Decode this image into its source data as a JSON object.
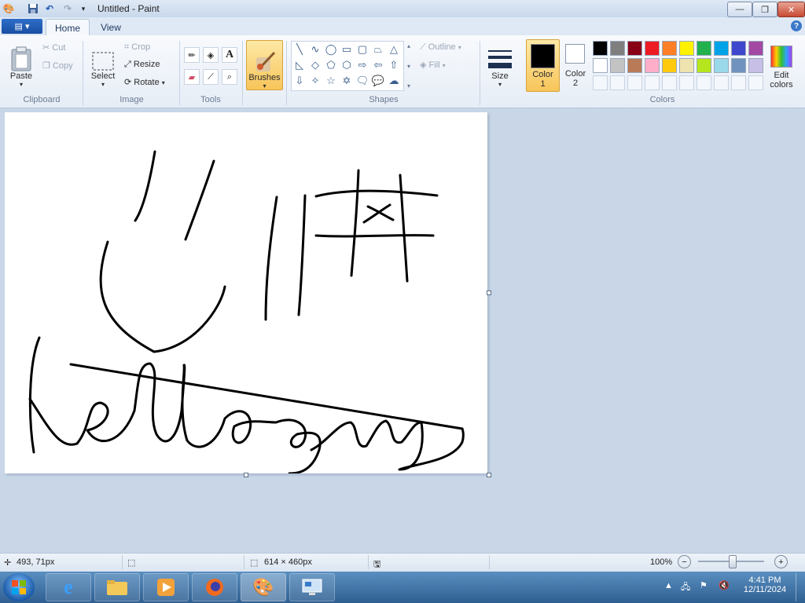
{
  "window": {
    "title": "Untitled - Paint",
    "minimize": "—",
    "maximize": "❐",
    "close": "✕"
  },
  "tabs": [
    {
      "label": "Home"
    },
    {
      "label": "View"
    }
  ],
  "ribbon": {
    "clipboard": {
      "group": "Clipboard",
      "paste": "Paste",
      "cut": "Cut",
      "copy": "Copy"
    },
    "image": {
      "group": "Image",
      "select": "Select",
      "crop": "Crop",
      "resize": "Resize",
      "rotate": "Rotate"
    },
    "tools": {
      "group": "Tools"
    },
    "brushes": {
      "label": "Brushes"
    },
    "shapes": {
      "group": "Shapes",
      "outline": "Outline",
      "fill": "Fill"
    },
    "size": {
      "label": "Size"
    },
    "color1": {
      "label": "Color",
      "num": "1",
      "value": "#000000"
    },
    "color2": {
      "label": "Color",
      "num": "2",
      "value": "#ffffff"
    },
    "colors": {
      "group": "Colors",
      "edit": "Edit",
      "edit2": "colors"
    }
  },
  "palette": [
    "#000000",
    "#7f7f7f",
    "#880015",
    "#ed1c24",
    "#ff7f27",
    "#fff200",
    "#22b14c",
    "#00a2e8",
    "#3f48cc",
    "#a349a4",
    "#ffffff",
    "#c3c3c3",
    "#b97a57",
    "#ffaec9",
    "#ffc90e",
    "#efe4b0",
    "#b5e61d",
    "#99d9ea",
    "#7092be",
    "#c8bfe7"
  ],
  "status": {
    "cursor": "493, 71px",
    "size": "614 × 460px",
    "zoom": "100%"
  },
  "taskbar": {
    "time": "4:41 PM",
    "date": "12/11/2024"
  }
}
